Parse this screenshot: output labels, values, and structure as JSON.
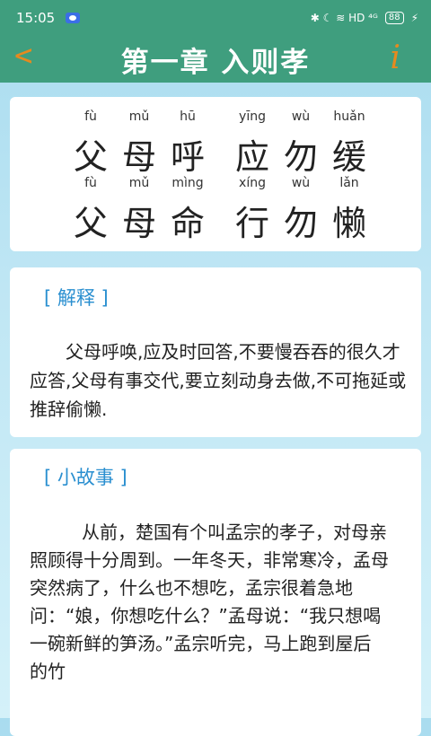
{
  "status_bar": {
    "time": "15:05",
    "indicators": "✱ ☾ ≋ HD ⁴ᴳ",
    "battery": "88"
  },
  "header": {
    "back_symbol": "<",
    "title": "第一章  入则孝",
    "info_symbol": "i"
  },
  "verse": {
    "line1": [
      {
        "pinyin": "fù",
        "char": "父"
      },
      {
        "pinyin": "mǔ",
        "char": "母"
      },
      {
        "pinyin": "hū",
        "char": "呼"
      },
      {
        "pinyin": "yīng",
        "char": "应"
      },
      {
        "pinyin": "wù",
        "char": "勿"
      },
      {
        "pinyin": "huǎn",
        "char": "缓"
      }
    ],
    "line2": [
      {
        "pinyin": "fù",
        "char": "父"
      },
      {
        "pinyin": "mǔ",
        "char": "母"
      },
      {
        "pinyin": "mìng",
        "char": "命"
      },
      {
        "pinyin": "xíng",
        "char": "行"
      },
      {
        "pinyin": "wù",
        "char": "勿"
      },
      {
        "pinyin": "lǎn",
        "char": "懒"
      }
    ]
  },
  "explanation": {
    "title": "[ 解释 ]",
    "text": "父母呼唤,应及时回答,不要慢吞吞的很久才应答,父母有事交代,要立刻动身去做,不可拖延或推辞偷懒."
  },
  "story": {
    "title": "[ 小故事  ]",
    "text": "从前，楚国有个叫孟宗的孝子，对母亲照顾得十分周到。一年冬天，非常寒冷，孟母突然病了，什么也不想吃，孟宗很着急地问：“娘，你想吃什么？”孟母说：“我只想喝一碗新鲜的笋汤。”孟宗听完，马上跑到屋后的竹"
  }
}
